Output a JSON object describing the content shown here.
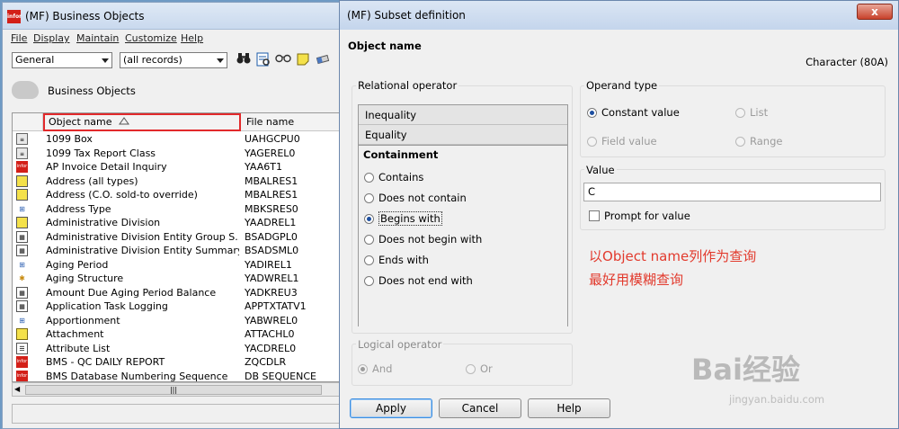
{
  "back_window": {
    "title": "(MF) Business Objects",
    "menu": [
      "File",
      "Display",
      "Maintain",
      "Customize",
      "Help"
    ],
    "view_combo": "General",
    "filter_combo": "(all records)",
    "section_label": "Business Objects",
    "columns": {
      "object_name": "Object name",
      "file_name": "File name"
    },
    "rows": [
      {
        "name": "1099 Box",
        "file": "UAHGCPU0",
        "icon": "doc-icon"
      },
      {
        "name": "1099 Tax Report Class",
        "file": "YAGEREL0",
        "icon": "doc-icon"
      },
      {
        "name": "AP Invoice Detail Inquiry",
        "file": "YAA6T1",
        "icon": "infor-icon"
      },
      {
        "name": "Address  (all types)",
        "file": "MBALRES1",
        "icon": "card-icon"
      },
      {
        "name": "Address (C.O. sold-to override)",
        "file": "MBALRES1",
        "icon": "card-icon"
      },
      {
        "name": "Address Type",
        "file": "MBKSRES0",
        "icon": "tree-icon"
      },
      {
        "name": "Administrative Division",
        "file": "YAADREL1",
        "icon": "card-icon"
      },
      {
        "name": "Administrative Division Entity Group S...",
        "file": "BSADGPL0",
        "icon": "grid-icon"
      },
      {
        "name": "Administrative Division Entity Summary",
        "file": "BSADSML0",
        "icon": "grid-icon"
      },
      {
        "name": "Aging Period",
        "file": "YADIREL1",
        "icon": "tree-icon"
      },
      {
        "name": "Aging Structure",
        "file": "YADWREL1",
        "icon": "tree-icon"
      },
      {
        "name": "Amount Due Aging Period Balance",
        "file": "YADKREU3",
        "icon": "grid-icon"
      },
      {
        "name": "Application Task Logging",
        "file": "APPTXTATV1",
        "icon": "grid-icon"
      },
      {
        "name": "Apportionment",
        "file": "YABWREL0",
        "icon": "tree-icon"
      },
      {
        "name": "Attachment",
        "file": "ATTACHL0",
        "icon": "note-icon"
      },
      {
        "name": "Attribute List",
        "file": "YACDREL0",
        "icon": "list-icon"
      },
      {
        "name": "BMS - QC DAILY REPORT",
        "file": "ZQCDLR",
        "icon": "infor-icon"
      },
      {
        "name": "BMS Database Numbering Sequence",
        "file": "DB SEQUENCE",
        "icon": "infor-icon"
      }
    ],
    "hscroll_grip": "|||"
  },
  "dialog": {
    "title": "(MF) Subset definition",
    "close_label": "x",
    "field_name": "Object name",
    "field_type": "Character (80A)",
    "relational_operator": {
      "label": "Relational operator",
      "tabs": [
        "Inequality",
        "Equality"
      ],
      "active_tab": "Containment",
      "options": [
        {
          "label": "Contains",
          "selected": false
        },
        {
          "label": "Does not contain",
          "selected": false
        },
        {
          "label": "Begins with",
          "selected": true
        },
        {
          "label": "Does not begin with",
          "selected": false
        },
        {
          "label": "Ends with",
          "selected": false
        },
        {
          "label": "Does not end with",
          "selected": false
        }
      ]
    },
    "operand_type": {
      "label": "Operand type",
      "options": [
        {
          "label": "Constant value",
          "selected": true,
          "enabled": true
        },
        {
          "label": "List",
          "selected": false,
          "enabled": false
        },
        {
          "label": "Field value",
          "selected": false,
          "enabled": false
        },
        {
          "label": "Range",
          "selected": false,
          "enabled": false
        }
      ]
    },
    "value": {
      "label": "Value",
      "input": "C",
      "prompt_label": "Prompt for value",
      "prompt_checked": false
    },
    "logical_operator": {
      "label": "Logical operator",
      "options": [
        {
          "label": "And",
          "selected": true
        },
        {
          "label": "Or",
          "selected": false
        }
      ]
    },
    "buttons": {
      "apply": "Apply",
      "cancel": "Cancel",
      "help": "Help"
    }
  },
  "annotation": {
    "line1_prefix": "以",
    "line1_bold": "Object name",
    "line1_suffix": "列作为查询",
    "line2": "最好用模糊查询",
    "color": "#e23a2d"
  },
  "watermark": {
    "text": "Bai经验",
    "url": "jingyan.baidu.com"
  },
  "colors": {
    "highlight_border": "#e2292b",
    "titlebar": "#c9d9ee"
  }
}
